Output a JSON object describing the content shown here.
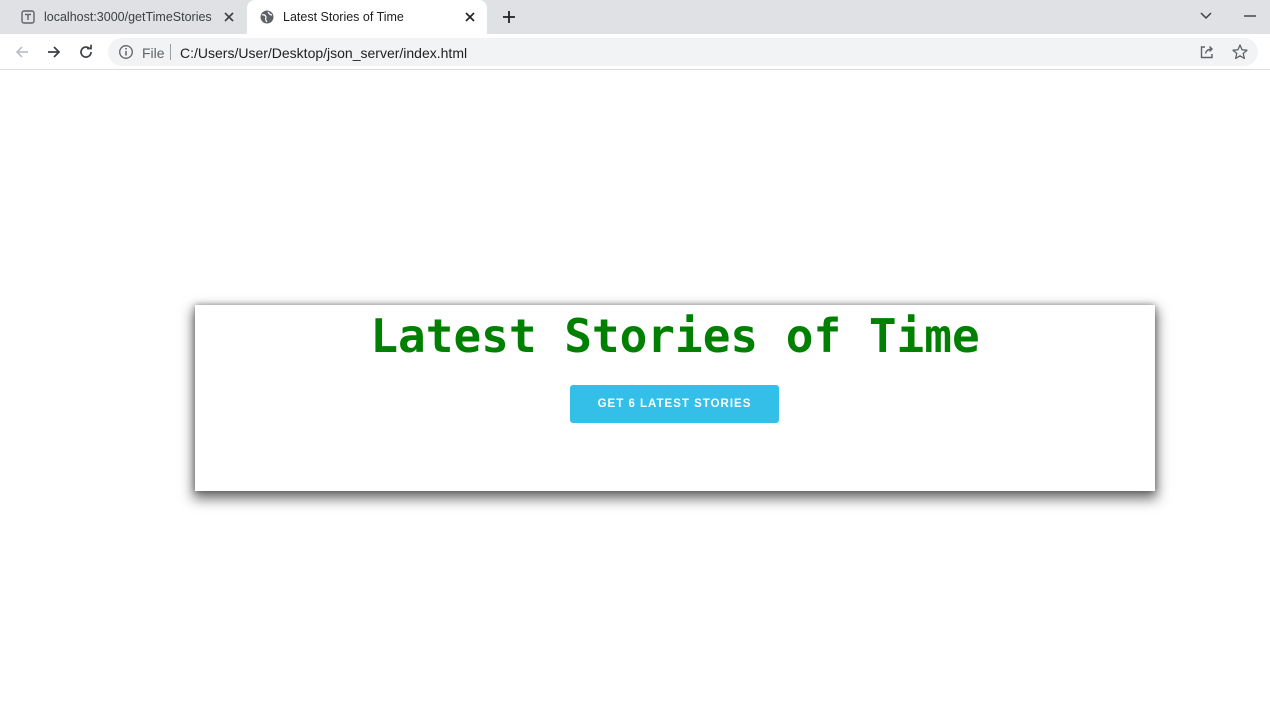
{
  "browser": {
    "tabs": [
      {
        "title": "localhost:3000/getTimeStories",
        "active": false
      },
      {
        "title": "Latest Stories of Time",
        "active": true
      }
    ],
    "address_bar": {
      "scheme_label": "File",
      "url": "C:/Users/User/Desktop/json_server/index.html"
    }
  },
  "page": {
    "heading": "Latest Stories of Time",
    "button_label": "GET 6 LATEST STORIES"
  },
  "colors": {
    "heading": "#008000",
    "button": "#33bfe8",
    "tabstrip": "#dfe1e5",
    "omnibox": "#f1f3f4"
  }
}
